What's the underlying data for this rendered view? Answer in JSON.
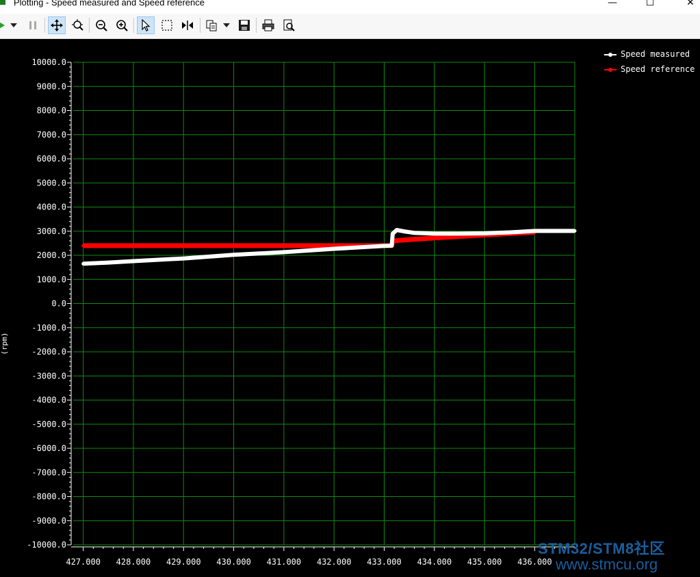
{
  "window": {
    "title": "Plotting - Speed measured and Speed reference",
    "minimize_glyph": "—",
    "maximize_glyph": "☐",
    "close_glyph": "✕"
  },
  "toolbar": {
    "items": [
      {
        "name": "play-icon",
        "active": false
      },
      {
        "name": "dropdown-arrow-icon",
        "active": false
      },
      {
        "name": "pause-icon",
        "active": false
      },
      {
        "name": "pan-icon",
        "active": true
      },
      {
        "name": "zoom-fit-icon",
        "active": false
      },
      {
        "name": "zoom-out-icon",
        "active": false
      },
      {
        "name": "zoom-in-icon",
        "active": false
      },
      {
        "name": "pointer-icon",
        "active": true
      },
      {
        "name": "select-rect-icon",
        "active": false
      },
      {
        "name": "cursor-split-icon",
        "active": false
      },
      {
        "name": "copy-icon",
        "active": false
      },
      {
        "name": "copy-dropdown-icon",
        "active": false
      },
      {
        "name": "save-icon",
        "active": false
      },
      {
        "name": "print-icon",
        "active": false
      },
      {
        "name": "print-preview-icon",
        "active": false
      }
    ]
  },
  "colors": {
    "background": "#000000",
    "grid": "#118c11",
    "axis": "#ffffff",
    "speed_measured": "#ffffff",
    "speed_reference": "#ff0000",
    "watermark": "#1a5e9e"
  },
  "chart_data": {
    "type": "line",
    "ylabel": "Speed (rpm)",
    "xlim": [
      426.8,
      436.8
    ],
    "ylim": [
      -10000,
      10000
    ],
    "x_ticks": [
      "427.000",
      "428.000",
      "429.000",
      "430.000",
      "431.000",
      "432.000",
      "433.000",
      "434.000",
      "435.000",
      "436.000"
    ],
    "y_ticks": [
      "10000.0",
      "9000.0",
      "8000.0",
      "7000.0",
      "6000.0",
      "5000.0",
      "4000.0",
      "3000.0",
      "2000.0",
      "1000.0",
      "0.0",
      "-1000.0",
      "-2000.0",
      "-3000.0",
      "-4000.0",
      "-5000.0",
      "-6000.0",
      "-7000.0",
      "-8000.0",
      "-9000.0",
      "-10000.0"
    ],
    "grid": true,
    "legend_position": "top-right",
    "series": [
      {
        "name": "Speed measured",
        "color": "#ffffff",
        "x": [
          427.0,
          427.5,
          428.0,
          429.0,
          430.0,
          431.0,
          432.0,
          433.0,
          433.15,
          433.17,
          433.25,
          433.4,
          433.6,
          434.0,
          434.5,
          435.0,
          435.5,
          436.0,
          436.8
        ],
        "y": [
          1650,
          1700,
          1760,
          1870,
          2020,
          2130,
          2270,
          2390,
          2400,
          2900,
          3050,
          2990,
          2930,
          2900,
          2900,
          2910,
          2950,
          3010,
          3010
        ]
      },
      {
        "name": "Speed reference",
        "color": "#ff0000",
        "x": [
          427.0,
          428.0,
          429.0,
          430.0,
          431.0,
          432.0,
          433.0,
          433.15,
          433.17,
          433.5,
          434.0,
          434.5,
          435.0,
          435.5,
          436.0
        ],
        "y": [
          2400,
          2400,
          2400,
          2400,
          2400,
          2400,
          2400,
          2400,
          2600,
          2650,
          2720,
          2780,
          2840,
          2900,
          2960
        ]
      }
    ]
  },
  "watermark": {
    "line1": "STM32/STM8社区",
    "line2": "www.stmcu.org"
  }
}
